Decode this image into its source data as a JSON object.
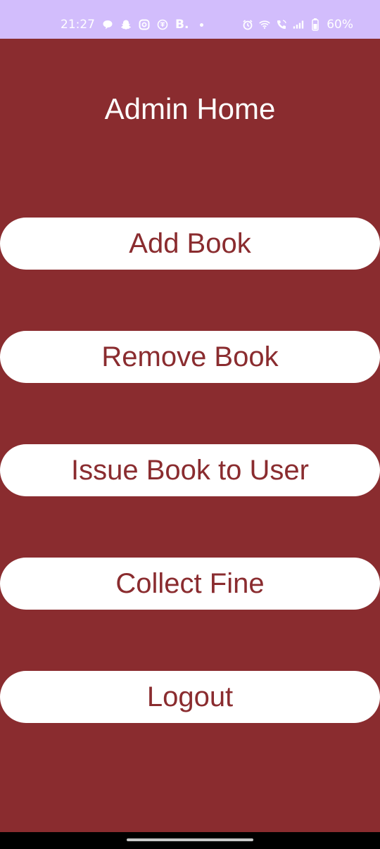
{
  "status_bar": {
    "time": "21:27",
    "b_label": "B.",
    "battery": "60%",
    "left_icons": [
      "chat-bubble-icon",
      "snapchat-icon",
      "messenger-icon",
      "hindi-keyboard-icon"
    ],
    "right_icons": [
      "alarm-icon",
      "wifi-icon",
      "wifi-call-icon",
      "signal-icon",
      "battery-icon"
    ]
  },
  "header": {
    "title": "Admin Home"
  },
  "menu": {
    "add_book": "Add Book",
    "remove_book": "Remove Book",
    "issue_book": "Issue Book to User",
    "collect_fine": "Collect Fine",
    "logout": "Logout"
  },
  "colors": {
    "background": "#8a2c2f",
    "status_bar": "#d2bdfc",
    "button_background": "#ffffff",
    "button_text": "#8a2c2f"
  }
}
